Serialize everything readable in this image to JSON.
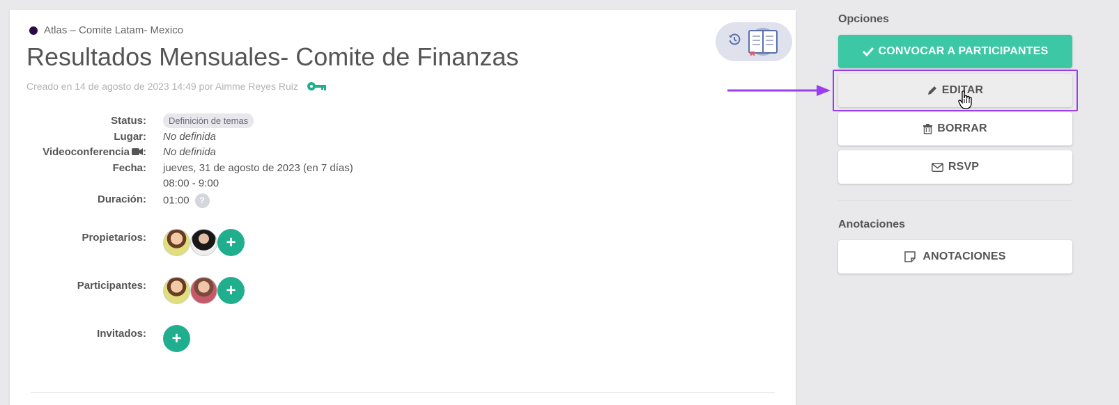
{
  "meeting": {
    "breadcrumb": "Atlas – Comite Latam- Mexico",
    "title": "Resultados Mensuales- Comite de Finanzas",
    "created": "Creado en 14 de agosto de 2023 14:49 por Aimme Reyes Ruiz",
    "labels": {
      "status": "Status:",
      "lugar": "Lugar:",
      "videoconferencia": "Videoconferencia",
      "videoconferencia_colon": ":",
      "fecha": "Fecha:",
      "duracion": "Duración:",
      "propietarios": "Propietarios:",
      "participantes": "Participantes:",
      "invitados": "Invitados:"
    },
    "values": {
      "status": "Definición de temas",
      "lugar": "No definida",
      "videoconferencia": "No definida",
      "fecha": "jueves, 31 de agosto de 2023  (en 7 días)",
      "hora": "08:00 - 9:00",
      "duracion": "01:00",
      "help": "?"
    },
    "add_symbol": "+"
  },
  "sidebar": {
    "opciones_title": "Opciones",
    "convocar_label": "CONVOCAR A PARTICIPANTES",
    "editar_label": "EDITAR",
    "borrar_label": "BORRAR",
    "rsvp_label": "RSVP",
    "anotaciones_title": "Anotaciones",
    "anotaciones_label": "ANOTACIONES"
  },
  "colors": {
    "accent_green": "#3cc8a4",
    "add_button": "#1fae8e",
    "highlight": "#9a3df0",
    "breadcrumb_dot": "#2a0a47"
  },
  "icons": [
    "key-icon",
    "history-icon",
    "book-icon",
    "video-camera-icon",
    "check-icon",
    "pencil-icon",
    "trash-icon",
    "envelope-icon",
    "note-icon",
    "hand-cursor-icon",
    "arrow-icon"
  ]
}
